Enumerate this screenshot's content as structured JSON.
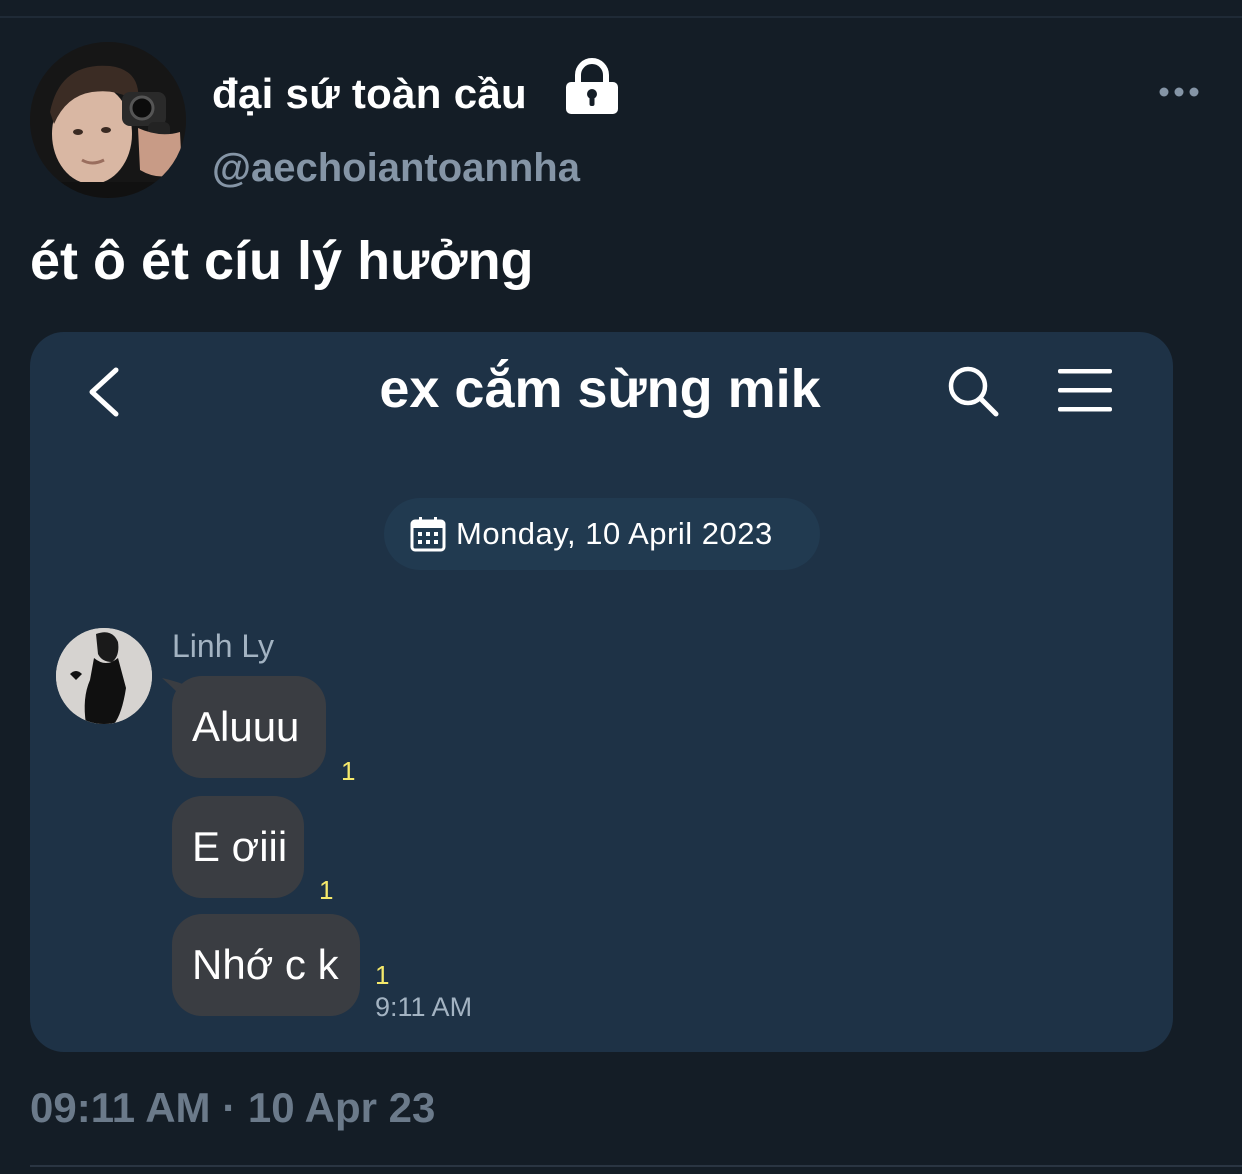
{
  "tweet": {
    "display_name": "đại sứ toàn cầu",
    "handle": "@aechoiantoannha",
    "text": "ét ô ét cíu lý hưởng",
    "timestamp": "09:11 AM · 10 Apr 23",
    "protected_icon": "lock-icon",
    "menu_icon": "more-dots-icon"
  },
  "chat": {
    "title": "ex cắm sừng mik",
    "date_label": "Monday, 10 April 2023",
    "contact_name": "Linh Ly",
    "messages": [
      {
        "text": "Aluuu",
        "read": "1"
      },
      {
        "text": "E ơiii",
        "read": "1"
      },
      {
        "text": "Nhớ c k",
        "read": "1"
      }
    ],
    "last_time": "9:11 AM",
    "icons": [
      "back-chevron-icon",
      "search-icon",
      "hamburger-menu-icon",
      "calendar-icon"
    ]
  },
  "colors": {
    "background": "#141d26",
    "card": "#1e3246",
    "bubble": "#3a3d42",
    "read_receipt": "#f5e96b",
    "muted_text": "#8595a6"
  }
}
